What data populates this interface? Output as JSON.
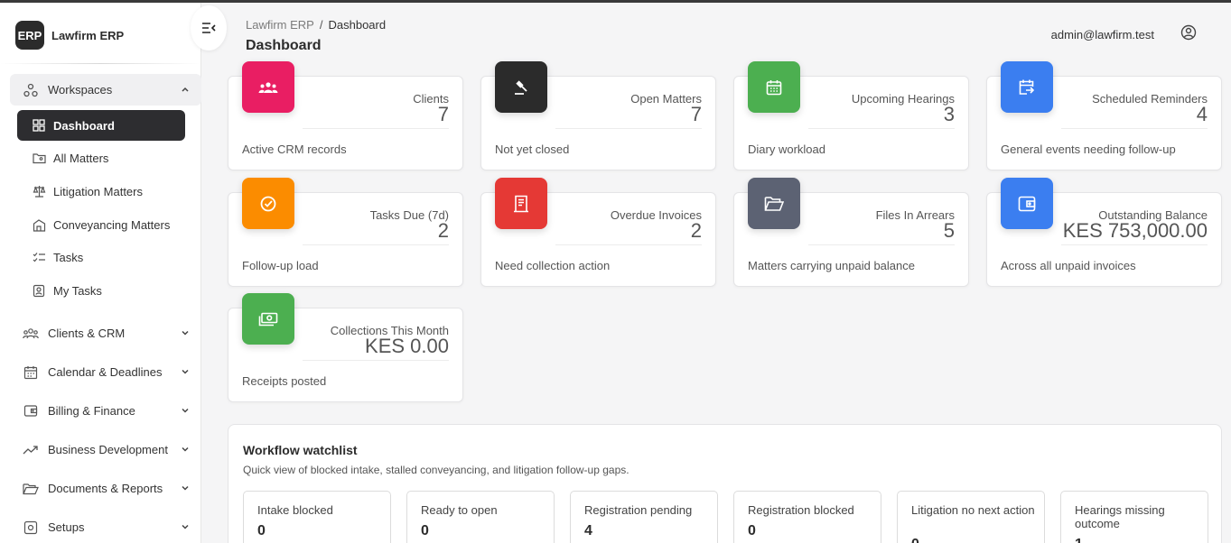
{
  "app": {
    "brand_logo": "ERP",
    "brand_name": "Lawfirm ERP"
  },
  "breadcrumb": {
    "root": "Lawfirm ERP",
    "separator": "/",
    "current": "Dashboard"
  },
  "page": {
    "title": "Dashboard"
  },
  "user": {
    "email": "admin@lawfirm.test"
  },
  "sidebar": {
    "workspaces_label": "Workspaces",
    "items": [
      {
        "label": "Dashboard",
        "icon": "grid-icon",
        "active": true
      },
      {
        "label": "All Matters",
        "icon": "folder-user-icon"
      },
      {
        "label": "Litigation Matters",
        "icon": "scales-icon"
      },
      {
        "label": "Conveyancing Matters",
        "icon": "building-icon"
      },
      {
        "label": "Tasks",
        "icon": "checklist-icon"
      },
      {
        "label": "My Tasks",
        "icon": "user-badge-icon"
      }
    ],
    "groups": [
      {
        "label": "Clients & CRM",
        "icon": "users-icon"
      },
      {
        "label": "Calendar & Deadlines",
        "icon": "calendar-icon"
      },
      {
        "label": "Billing & Finance",
        "icon": "wallet-icon"
      },
      {
        "label": "Business Development",
        "icon": "trend-icon"
      },
      {
        "label": "Documents & Reports",
        "icon": "folder-open-icon"
      },
      {
        "label": "Setups",
        "icon": "gear-icon"
      }
    ]
  },
  "cards": [
    {
      "label": "Clients",
      "value": "7",
      "foot": "Active CRM records",
      "color": "#e91e63",
      "icon": "users-icon"
    },
    {
      "label": "Open Matters",
      "value": "7",
      "foot": "Not yet closed",
      "color": "#2b2b2b",
      "icon": "gavel-icon"
    },
    {
      "label": "Upcoming Hearings",
      "value": "3",
      "foot": "Diary workload",
      "color": "#4caf50",
      "icon": "calendar-icon"
    },
    {
      "label": "Scheduled Reminders",
      "value": "4",
      "foot": "General events needing follow-up",
      "color": "#3b7ef0",
      "icon": "calendar-arrow-icon"
    },
    {
      "label": "Tasks Due (7d)",
      "value": "2",
      "foot": "Follow-up load",
      "color": "#fb8c00",
      "icon": "check-circle-icon"
    },
    {
      "label": "Overdue Invoices",
      "value": "2",
      "foot": "Need collection action",
      "color": "#e53935",
      "icon": "receipt-icon"
    },
    {
      "label": "Files In Arrears",
      "value": "5",
      "foot": "Matters carrying unpaid balance",
      "color": "#5c6273",
      "icon": "folder-open-icon"
    },
    {
      "label": "Outstanding Balance",
      "value": "KES 753,000.00",
      "foot": "Across all unpaid invoices",
      "color": "#3b7ef0",
      "icon": "wallet-icon"
    },
    {
      "label": "Collections This Month",
      "value": "KES 0.00",
      "foot": "Receipts posted",
      "color": "#4caf50",
      "icon": "cash-icon"
    }
  ],
  "watchlist": {
    "title": "Workflow watchlist",
    "subtitle": "Quick view of blocked intake, stalled conveyancing, and litigation follow-up gaps.",
    "items": [
      {
        "label": "Intake blocked",
        "value": "0"
      },
      {
        "label": "Ready to open",
        "value": "0"
      },
      {
        "label": "Registration pending",
        "value": "4"
      },
      {
        "label": "Registration blocked",
        "value": "0"
      },
      {
        "label": "Litigation no next action",
        "value": "0"
      },
      {
        "label": "Hearings missing outcome",
        "value": "1"
      }
    ]
  }
}
